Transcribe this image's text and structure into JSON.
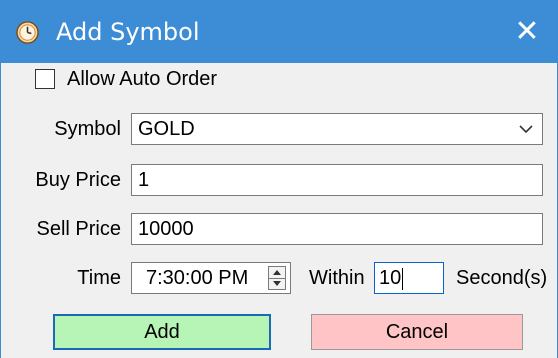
{
  "window": {
    "title": "Add Symbol",
    "close_glyph": "✕",
    "titlebar_color": "#3d8dd6",
    "app_icon": "clock-icon"
  },
  "form": {
    "allow_auto_order_label": "Allow Auto Order",
    "allow_auto_order_checked": false,
    "symbol_label": "Symbol",
    "symbol_value": "GOLD",
    "buy_price_label": "Buy Price",
    "buy_price_value": "1",
    "sell_price_label": "Sell Price",
    "sell_price_value": "10000",
    "time_label": "Time",
    "time_value": "7:30:00 PM",
    "within_label": "Within",
    "within_value": "10",
    "seconds_label": "Second(s)"
  },
  "buttons": {
    "add_label": "Add",
    "add_color": "#b6f5b6",
    "cancel_label": "Cancel",
    "cancel_color": "#ffc4c6"
  }
}
